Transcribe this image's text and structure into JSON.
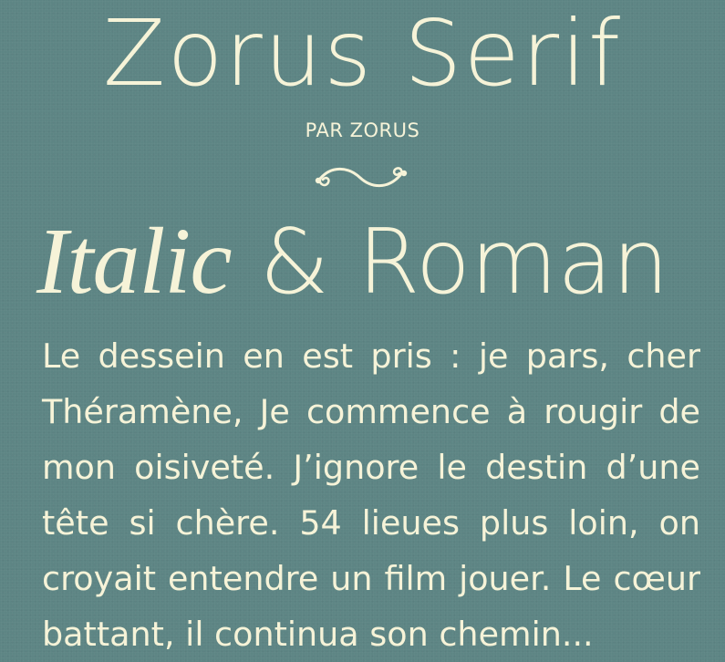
{
  "poster": {
    "title": "Zorus Serif",
    "byline": "PAR ZORUS",
    "ornament_icon": "swash-ornament-icon",
    "subtitle_italic": "Italic",
    "subtitle_rest": "& Roman",
    "body": "Le dessein en est pris : je pars, cher Théramène, Je commence à rougir de mon oisiveté. J’ignore le destin d’une tête si chère. 54 lieues plus loin, on croyait entendre un film jouer. Le cœur battant, il continua son chemin..."
  },
  "colors": {
    "background": "#5d8584",
    "ink": "#f6f3d8"
  }
}
